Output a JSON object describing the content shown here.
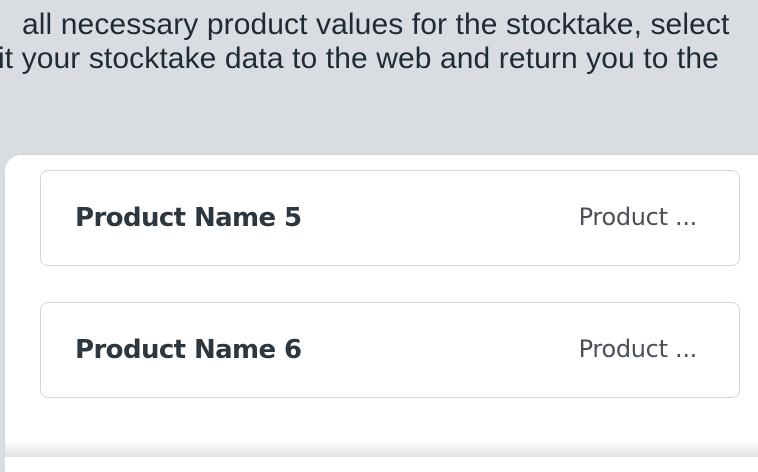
{
  "instructions": {
    "line1": "all necessary product values for the stocktake, select",
    "line2": "it your stocktake data to the web and return you to the"
  },
  "products": [
    {
      "name": "Product Name 5",
      "value": "Product ..."
    },
    {
      "name": "Product Name 6",
      "value": "Product ..."
    }
  ],
  "colors": {
    "background": "#d9dde1",
    "text": "#1e2a35",
    "card_border": "#d2d6da",
    "card_background": "#ffffff"
  }
}
